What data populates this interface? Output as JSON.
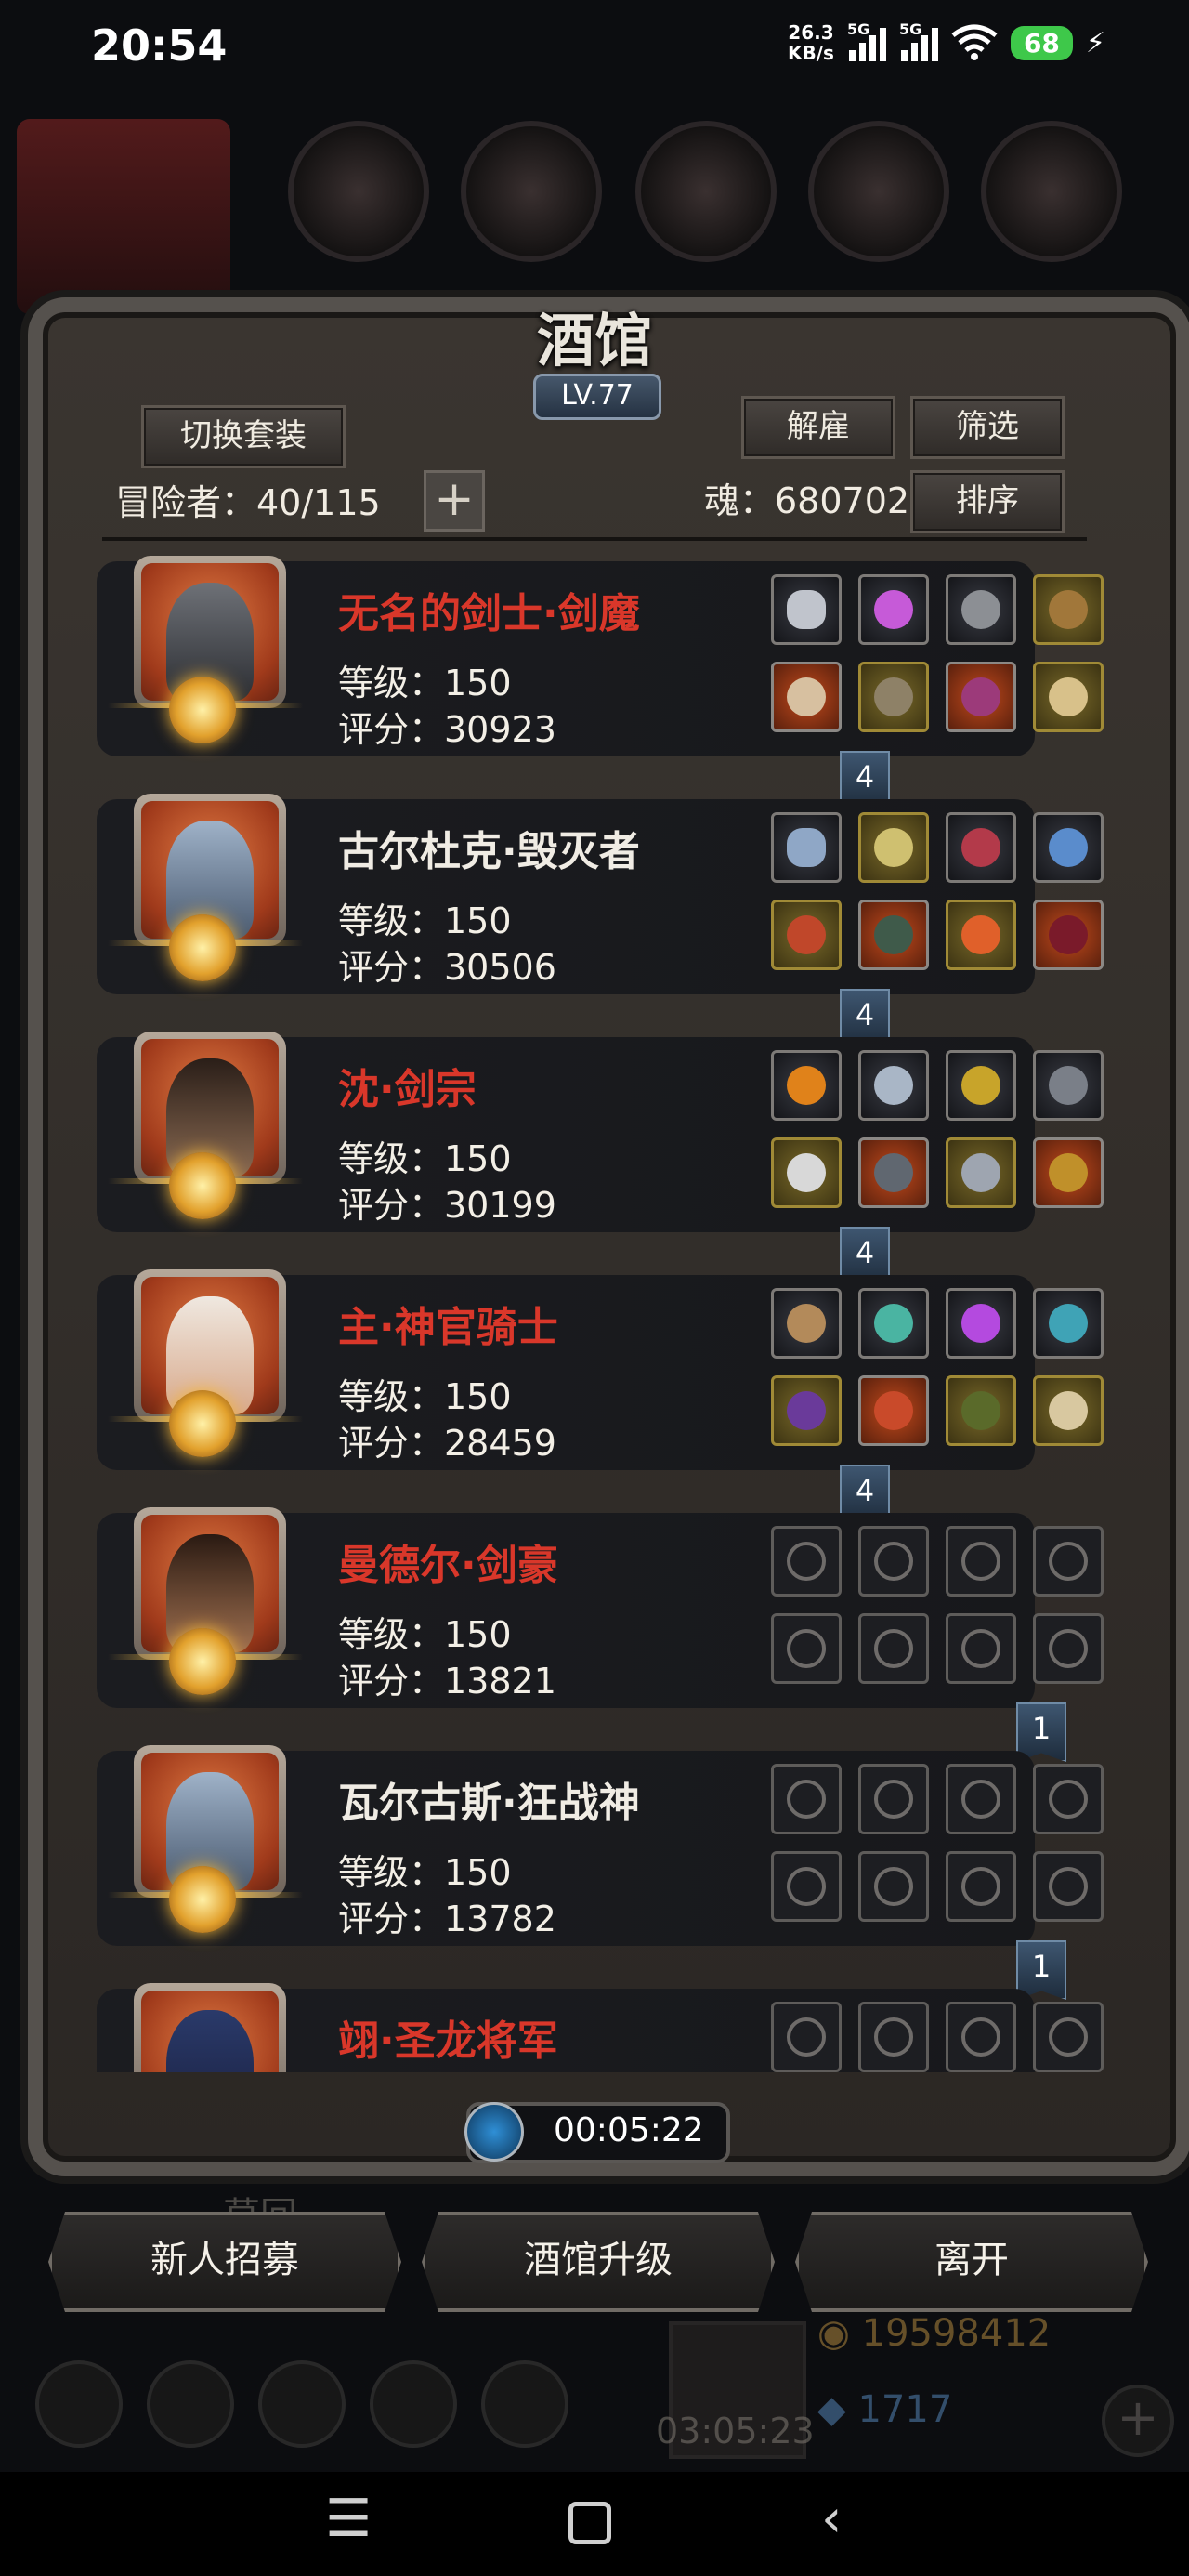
{
  "status_bar": {
    "time": "20:54",
    "speed": "26.3",
    "speed_unit": "KB/s",
    "net1": "5G",
    "net2": "5G",
    "wifi_num": "6",
    "battery": "68"
  },
  "panel": {
    "title": "酒馆",
    "level": "LV.77",
    "switch_set_label": "切换套装",
    "dismiss_label": "解雇",
    "filter_label": "筛选",
    "sort_label": "排序",
    "adventurers_label": "冒险者：40/115",
    "soul_label": "魂：680702",
    "plus_icon": "plus-icon"
  },
  "heroes": [
    {
      "name": "无名的剑士·剑魔",
      "level": "等级：150",
      "score": "评分：30923",
      "set_count": "4"
    },
    {
      "name": "古尔杜克·毁灭者",
      "level": "等级：150",
      "score": "评分：30506",
      "set_count": "4"
    },
    {
      "name": "沈·剑宗",
      "level": "等级：150",
      "score": "评分：30199",
      "set_count": "4"
    },
    {
      "name": "主·神官骑士",
      "level": "等级：150",
      "score": "评分：28459",
      "set_count": "4"
    },
    {
      "name": "曼德尔·剑豪",
      "level": "等级：150",
      "score": "评分：13821",
      "set_count": "1"
    },
    {
      "name": "瓦尔古斯·狂战神",
      "level": "等级：150",
      "score": "评分：13782",
      "set_count": "1"
    },
    {
      "name": "翊·圣龙将军"
    }
  ],
  "timer": "00:05:22",
  "actions": {
    "recruit": "新人招募",
    "upgrade": "酒馆升级",
    "leave": "离开"
  },
  "background": {
    "gold": "19598412",
    "gems": "1717",
    "gift_timer": "03:05:23",
    "dim_label": "草回"
  }
}
